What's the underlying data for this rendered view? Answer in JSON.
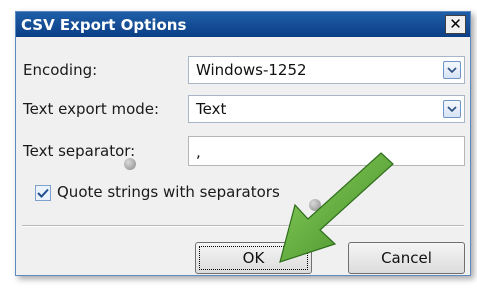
{
  "dialog": {
    "title": "CSV Export Options",
    "close_glyph": "✕",
    "encoding": {
      "label": "Encoding:",
      "value": "Windows-1252"
    },
    "text_export_mode": {
      "label": "Text export mode:",
      "value": "Text"
    },
    "text_separator": {
      "label": "Text separator:",
      "value": ","
    },
    "quote_strings": {
      "label": "Quote strings with separators",
      "checked": true
    },
    "buttons": {
      "ok": "OK",
      "cancel": "Cancel"
    }
  },
  "annotation": {
    "icon": "green-arrow-icon",
    "color": "#5aa83a"
  },
  "colors": {
    "titlebar": "#0b3e86",
    "dialog_bg": "#f0f0f0"
  }
}
